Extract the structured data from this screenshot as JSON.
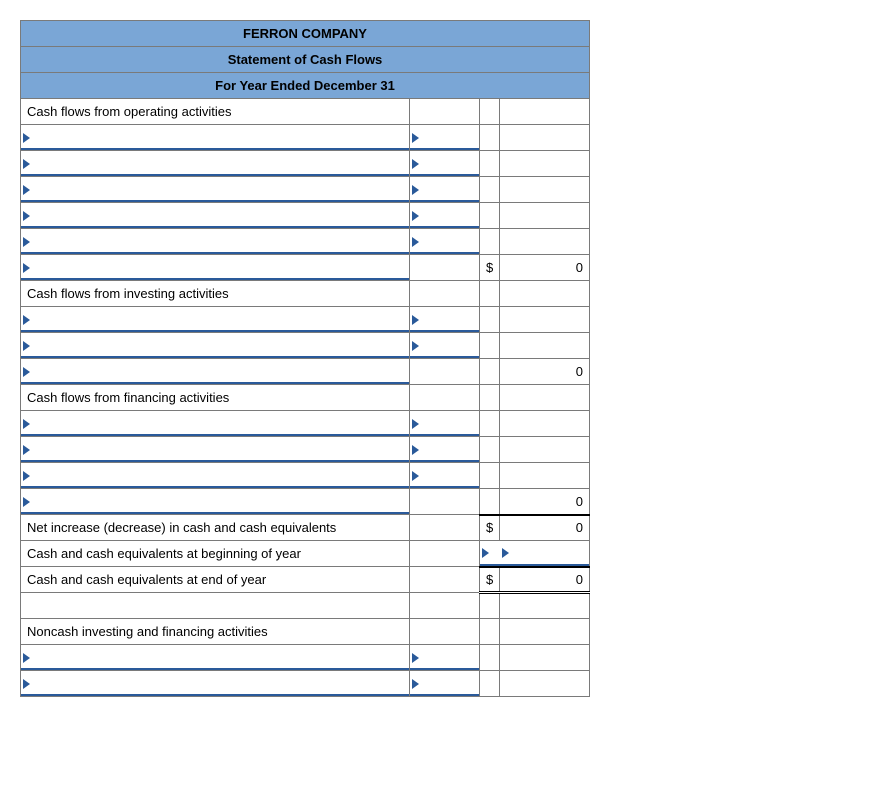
{
  "header": {
    "company": "FERRON COMPANY",
    "title": "Statement of Cash Flows",
    "period": "For Year Ended December 31"
  },
  "sections": {
    "operating": "Cash flows from operating activities",
    "investing": "Cash flows from investing activities",
    "financing": "Cash flows from financing activities",
    "netincrease": "Net increase (decrease) in cash and cash equivalents",
    "beginning": "Cash and cash equivalents at beginning of year",
    "ending": "Cash and cash equivalents at end of year",
    "noncash": "Noncash investing and financing activities"
  },
  "currency": "$",
  "values": {
    "operating_total": "0",
    "investing_total": "0",
    "financing_total": "0",
    "netincrease": "0",
    "ending": "0"
  }
}
